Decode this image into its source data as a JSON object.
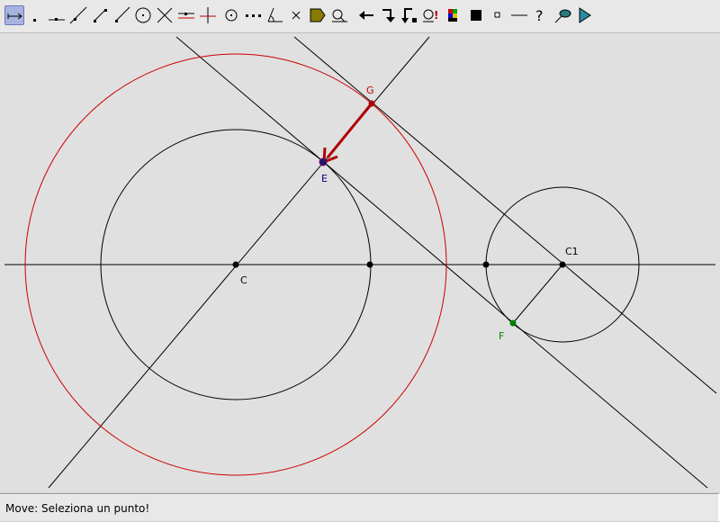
{
  "toolbar": {
    "tools": [
      {
        "name": "move-tool-icon",
        "active": true
      },
      {
        "name": "point-tool-icon"
      },
      {
        "name": "point-on-line-tool-icon"
      },
      {
        "name": "line-tool-icon"
      },
      {
        "name": "segment-tool-icon"
      },
      {
        "name": "ray-tool-icon"
      },
      {
        "name": "circle-tool-icon"
      },
      {
        "name": "intersection-tool-icon"
      },
      {
        "name": "parallel-tool-icon"
      },
      {
        "name": "perpendicular-tool-icon"
      },
      {
        "name": "circle-center-tool-icon"
      },
      {
        "name": "midpoint-tool-icon"
      },
      {
        "name": "angle-tool-icon"
      },
      {
        "name": "delete-tool-icon"
      },
      {
        "name": "label-tool-icon"
      },
      {
        "name": "measure-tool-icon"
      },
      {
        "name": "undo-tool-icon"
      },
      {
        "name": "redo-tool-icon"
      },
      {
        "name": "hide-tool-icon"
      },
      {
        "name": "show-hidden-tool-icon"
      },
      {
        "name": "color-palette-tool-icon"
      },
      {
        "name": "fill-black-tool-icon"
      },
      {
        "name": "point-style-tool-icon"
      },
      {
        "name": "line-style-tool-icon"
      },
      {
        "name": "help-tool-icon"
      },
      {
        "name": "trace-tool-icon"
      },
      {
        "name": "play-tool-icon"
      }
    ]
  },
  "canvas": {
    "labels": {
      "C": "C",
      "C1": "C1",
      "E": "E",
      "F": "F",
      "G": "G"
    },
    "colors": {
      "background": "#e0e0e0",
      "line": "#000000",
      "red_circle": "#cc0000",
      "arrow": "#b00000",
      "label_G": "#c00000",
      "label_E": "#000080",
      "label_F": "#008000"
    }
  },
  "status": {
    "text": "Move: Seleziona un punto!"
  }
}
